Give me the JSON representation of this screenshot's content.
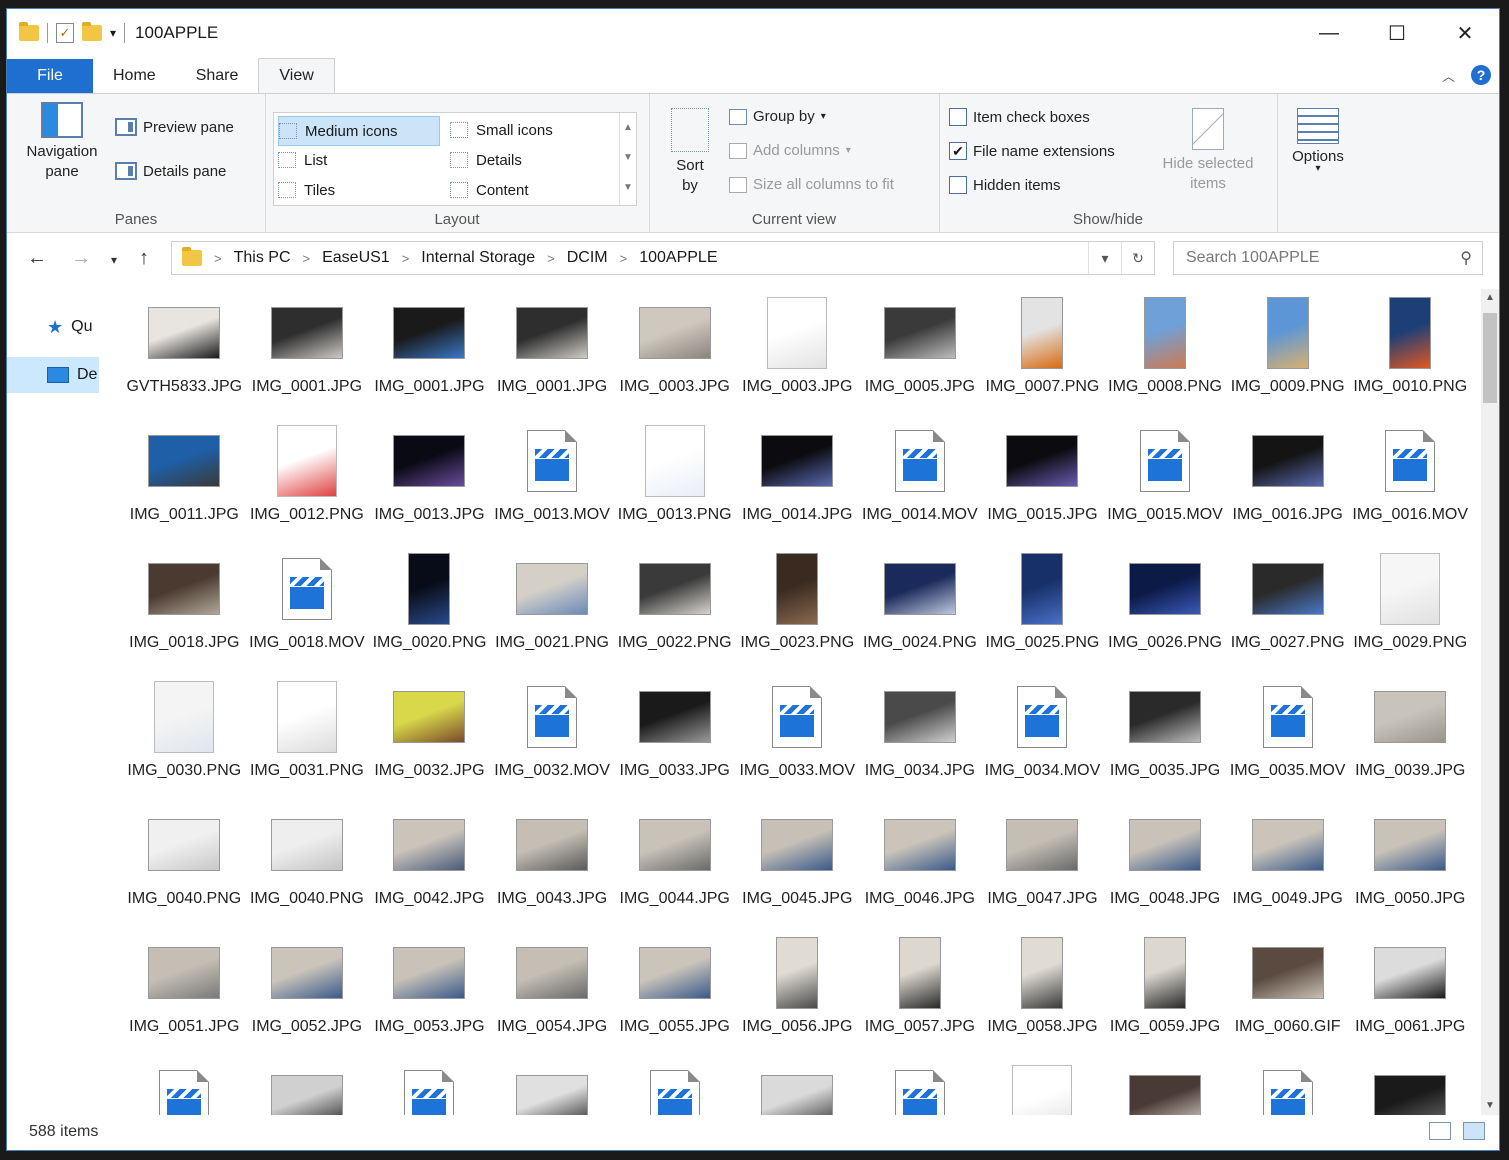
{
  "window": {
    "title": "100APPLE"
  },
  "ribbon_tabs": [
    "File",
    "Home",
    "Share",
    "View"
  ],
  "panes": {
    "navigation_pane": "Navigation pane",
    "preview_pane": "Preview pane",
    "details_pane": "Details pane",
    "label": "Panes"
  },
  "layout": {
    "items": [
      "Medium icons",
      "Small icons",
      "List",
      "Details",
      "Tiles",
      "Content"
    ],
    "selected": "Medium icons",
    "label": "Layout"
  },
  "current_view": {
    "sort_by": "Sort by",
    "group_by": "Group by",
    "add_columns": "Add columns",
    "size_columns": "Size all columns to fit",
    "label": "Current view"
  },
  "show_hide": {
    "item_check_boxes": "Item check boxes",
    "file_name_extensions": "File name extensions",
    "hidden_items": "Hidden items",
    "hide_selected": "Hide selected items",
    "label": "Show/hide",
    "checked": {
      "item_check_boxes": false,
      "file_name_extensions": true,
      "hidden_items": false
    }
  },
  "options": {
    "label": "Options"
  },
  "breadcrumb": [
    "This PC",
    "EaseUS1",
    "Internal Storage",
    "DCIM",
    "100APPLE"
  ],
  "search": {
    "placeholder": "Search 100APPLE"
  },
  "nav_pane": {
    "items": [
      "Qu",
      "De"
    ]
  },
  "files": [
    {
      "name": "GVTH5833.JPG",
      "type": "img",
      "shape": "land",
      "c1": "#e8e4e0",
      "c2": "#1a1a1a"
    },
    {
      "name": "IMG_0001.JPG",
      "type": "img",
      "shape": "land",
      "c1": "#2e2e2e",
      "c2": "#cfcac4"
    },
    {
      "name": "IMG_0001.JPG",
      "type": "img",
      "shape": "land",
      "c1": "#1a1a1a",
      "c2": "#3a78c8"
    },
    {
      "name": "IMG_0001.JPG",
      "type": "img",
      "shape": "land",
      "c1": "#2e2e2e",
      "c2": "#d0ccc6"
    },
    {
      "name": "IMG_0003.JPG",
      "type": "img",
      "shape": "land",
      "c1": "#cfc8bf",
      "c2": "#8a847c"
    },
    {
      "name": "IMG_0003.JPG",
      "type": "img",
      "shape": "doc",
      "c1": "#ffffff",
      "c2": "#e2e2e2"
    },
    {
      "name": "IMG_0005.JPG",
      "type": "img",
      "shape": "land",
      "c1": "#3a3a3a",
      "c2": "#bdbdbd"
    },
    {
      "name": "IMG_0007.PNG",
      "type": "img",
      "shape": "port",
      "c1": "#e3e3e3",
      "c2": "#d86a10"
    },
    {
      "name": "IMG_0008.PNG",
      "type": "img",
      "shape": "port",
      "c1": "#6fa0d8",
      "c2": "#d07a50"
    },
    {
      "name": "IMG_0009.PNG",
      "type": "img",
      "shape": "port",
      "c1": "#5c96d6",
      "c2": "#d8b070"
    },
    {
      "name": "IMG_0010.PNG",
      "type": "img",
      "shape": "port",
      "c1": "#1c3f78",
      "c2": "#e05820"
    },
    {
      "name": "IMG_0011.JPG",
      "type": "img",
      "shape": "land",
      "c1": "#1e5fa8",
      "c2": "#3a3a3a"
    },
    {
      "name": "IMG_0012.PNG",
      "type": "img",
      "shape": "doc",
      "c1": "#ffffff",
      "c2": "#e04040"
    },
    {
      "name": "IMG_0013.JPG",
      "type": "img",
      "shape": "land",
      "c1": "#0a0a14",
      "c2": "#6a4c9c"
    },
    {
      "name": "IMG_0013.MOV",
      "type": "vid"
    },
    {
      "name": "IMG_0013.PNG",
      "type": "img",
      "shape": "doc",
      "c1": "#ffffff",
      "c2": "#e8eef6"
    },
    {
      "name": "IMG_0014.JPG",
      "type": "img",
      "shape": "land",
      "c1": "#0c0c10",
      "c2": "#5a6ab0"
    },
    {
      "name": "IMG_0014.MOV",
      "type": "vid"
    },
    {
      "name": "IMG_0015.JPG",
      "type": "img",
      "shape": "land",
      "c1": "#0c0c10",
      "c2": "#6a5ab0"
    },
    {
      "name": "IMG_0015.MOV",
      "type": "vid"
    },
    {
      "name": "IMG_0016.JPG",
      "type": "img",
      "shape": "land",
      "c1": "#141414",
      "c2": "#5a6ab0"
    },
    {
      "name": "IMG_0016.MOV",
      "type": "vid"
    },
    {
      "name": "IMG_0018.JPG",
      "type": "img",
      "shape": "land",
      "c1": "#4a3a30",
      "c2": "#b0a898"
    },
    {
      "name": "IMG_0018.MOV",
      "type": "vid"
    },
    {
      "name": "IMG_0020.PNG",
      "type": "img",
      "shape": "port",
      "c1": "#080c18",
      "c2": "#2a4a8a"
    },
    {
      "name": "IMG_0021.PNG",
      "type": "img",
      "shape": "land",
      "c1": "#d4d0c8",
      "c2": "#6a8ab8"
    },
    {
      "name": "IMG_0022.PNG",
      "type": "img",
      "shape": "land",
      "c1": "#3a3a3a",
      "c2": "#d8d4cc"
    },
    {
      "name": "IMG_0023.PNG",
      "type": "img",
      "shape": "port",
      "c1": "#3a2a20",
      "c2": "#8a6a50"
    },
    {
      "name": "IMG_0024.PNG",
      "type": "img",
      "shape": "land",
      "c1": "#1a2a5a",
      "c2": "#c0c8e0"
    },
    {
      "name": "IMG_0025.PNG",
      "type": "img",
      "shape": "port",
      "c1": "#18306a",
      "c2": "#4a70c8"
    },
    {
      "name": "IMG_0026.PNG",
      "type": "img",
      "shape": "land",
      "c1": "#0c1a48",
      "c2": "#3a5ab8"
    },
    {
      "name": "IMG_0027.PNG",
      "type": "img",
      "shape": "land",
      "c1": "#2a2a2a",
      "c2": "#4a78c8"
    },
    {
      "name": "IMG_0029.PNG",
      "type": "img",
      "shape": "doc",
      "c1": "#f6f6f6",
      "c2": "#e0e0e0"
    },
    {
      "name": "IMG_0030.PNG",
      "type": "img",
      "shape": "doc",
      "c1": "#f4f4f4",
      "c2": "#dfe6ee"
    },
    {
      "name": "IMG_0031.PNG",
      "type": "img",
      "shape": "doc",
      "c1": "#ffffff",
      "c2": "#dcdcdc"
    },
    {
      "name": "IMG_0032.JPG",
      "type": "img",
      "shape": "land",
      "c1": "#d8d84a",
      "c2": "#7a4a2a"
    },
    {
      "name": "IMG_0032.MOV",
      "type": "vid"
    },
    {
      "name": "IMG_0033.JPG",
      "type": "img",
      "shape": "land",
      "c1": "#1a1a1a",
      "c2": "#9a9a9a"
    },
    {
      "name": "IMG_0033.MOV",
      "type": "vid"
    },
    {
      "name": "IMG_0034.JPG",
      "type": "img",
      "shape": "land",
      "c1": "#4a4a4a",
      "c2": "#d0d0d0"
    },
    {
      "name": "IMG_0034.MOV",
      "type": "vid"
    },
    {
      "name": "IMG_0035.JPG",
      "type": "img",
      "shape": "land",
      "c1": "#2a2a2a",
      "c2": "#bcbcbc"
    },
    {
      "name": "IMG_0035.MOV",
      "type": "vid"
    },
    {
      "name": "IMG_0039.JPG",
      "type": "img",
      "shape": "land",
      "c1": "#c8c4bc",
      "c2": "#9a948a"
    },
    {
      "name": "IMG_0040.PNG",
      "type": "img",
      "shape": "land",
      "c1": "#f0f0f0",
      "c2": "#c8c8c8"
    },
    {
      "name": "IMG_0040.PNG",
      "type": "img",
      "shape": "land",
      "c1": "#eeeeee",
      "c2": "#c4c4c4"
    },
    {
      "name": "IMG_0042.JPG",
      "type": "img",
      "shape": "land",
      "c1": "#cac4ba",
      "c2": "#4a5a7a"
    },
    {
      "name": "IMG_0043.JPG",
      "type": "img",
      "shape": "land",
      "c1": "#c4beb4",
      "c2": "#5a5a5a"
    },
    {
      "name": "IMG_0044.JPG",
      "type": "img",
      "shape": "land",
      "c1": "#c8c2b8",
      "c2": "#6a6a6a"
    },
    {
      "name": "IMG_0045.JPG",
      "type": "img",
      "shape": "land",
      "c1": "#c6c0b6",
      "c2": "#3a5a8a"
    },
    {
      "name": "IMG_0046.JPG",
      "type": "img",
      "shape": "land",
      "c1": "#cac4ba",
      "c2": "#3a5a8a"
    },
    {
      "name": "IMG_0047.JPG",
      "type": "img",
      "shape": "land",
      "c1": "#c4beb4",
      "c2": "#6a6a6a"
    },
    {
      "name": "IMG_0048.JPG",
      "type": "img",
      "shape": "land",
      "c1": "#c8c2b8",
      "c2": "#3a5a8a"
    },
    {
      "name": "IMG_0049.JPG",
      "type": "img",
      "shape": "land",
      "c1": "#cac4ba",
      "c2": "#3a5a8a"
    },
    {
      "name": "IMG_0050.JPG",
      "type": "img",
      "shape": "land",
      "c1": "#c8c2b8",
      "c2": "#3a5a8a"
    },
    {
      "name": "IMG_0051.JPG",
      "type": "img",
      "shape": "land",
      "c1": "#c4beb4",
      "c2": "#7a7a7a"
    },
    {
      "name": "IMG_0052.JPG",
      "type": "img",
      "shape": "land",
      "c1": "#cac4ba",
      "c2": "#3a5a8a"
    },
    {
      "name": "IMG_0053.JPG",
      "type": "img",
      "shape": "land",
      "c1": "#c8c2b8",
      "c2": "#3a5a8a"
    },
    {
      "name": "IMG_0054.JPG",
      "type": "img",
      "shape": "land",
      "c1": "#c4beb4",
      "c2": "#6a6a6a"
    },
    {
      "name": "IMG_0055.JPG",
      "type": "img",
      "shape": "land",
      "c1": "#cac4ba",
      "c2": "#3a5a8a"
    },
    {
      "name": "IMG_0056.JPG",
      "type": "img",
      "shape": "port",
      "c1": "#e0dcd4",
      "c2": "#4a4a4a"
    },
    {
      "name": "IMG_0057.JPG",
      "type": "img",
      "shape": "port",
      "c1": "#dcd8d0",
      "c2": "#2a2a2a"
    },
    {
      "name": "IMG_0058.JPG",
      "type": "img",
      "shape": "port",
      "c1": "#e0dcd4",
      "c2": "#3a3a3a"
    },
    {
      "name": "IMG_0059.JPG",
      "type": "img",
      "shape": "port",
      "c1": "#dcd8d0",
      "c2": "#2a2a2a"
    },
    {
      "name": "IMG_0060.GIF",
      "type": "img",
      "shape": "land",
      "c1": "#5a4a40",
      "c2": "#c8c0b4"
    },
    {
      "name": "IMG_0061.JPG",
      "type": "img",
      "shape": "land",
      "c1": "#dcdcdc",
      "c2": "#1a1a1a"
    },
    {
      "name": "",
      "type": "vid"
    },
    {
      "name": "",
      "type": "img",
      "shape": "land",
      "c1": "#d0d0d0",
      "c2": "#2a2a2a"
    },
    {
      "name": "",
      "type": "vid"
    },
    {
      "name": "",
      "type": "img",
      "shape": "land",
      "c1": "#e0e0e0",
      "c2": "#2a2a2a"
    },
    {
      "name": "",
      "type": "vid"
    },
    {
      "name": "",
      "type": "img",
      "shape": "land",
      "c1": "#dadada",
      "c2": "#3a3a3a"
    },
    {
      "name": "",
      "type": "vid"
    },
    {
      "name": "",
      "type": "img",
      "shape": "doc",
      "c1": "#ffffff",
      "c2": "#dcdcdc"
    },
    {
      "name": "",
      "type": "img",
      "shape": "land",
      "c1": "#4a3a36",
      "c2": "#d8d0c8"
    },
    {
      "name": "",
      "type": "vid"
    },
    {
      "name": "",
      "type": "img",
      "shape": "land",
      "c1": "#1a1a1a",
      "c2": "#6a6a6a"
    }
  ],
  "status": {
    "item_count": "588 items"
  }
}
